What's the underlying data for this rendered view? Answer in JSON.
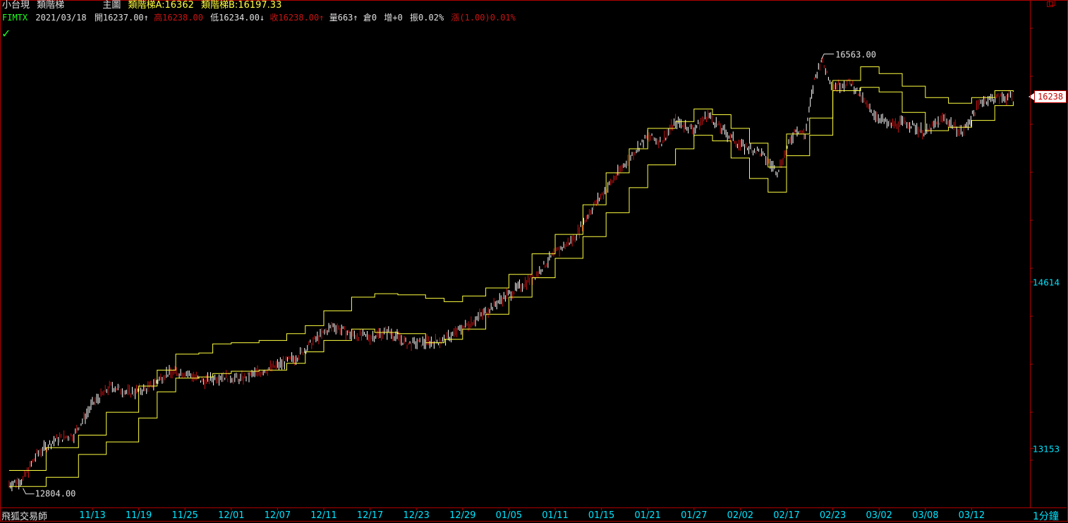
{
  "header": {
    "symbol_name": "小台現",
    "indicator_name": "類階梯",
    "panel_label": "主圖",
    "ladder_a_label": "類階梯A:16362",
    "ladder_b_label": "類階梯B:16197.33",
    "code": "FIMTX",
    "date": "2021/03/18",
    "open": "開16237.00",
    "high": "高16238.00",
    "low": "低16234.00",
    "close": "收16238.00",
    "volume": "量663",
    "oi": "倉0",
    "oi_change": "增+0",
    "amplitude": "振0.02%",
    "change": "漲(1.00)0.01%"
  },
  "footer": {
    "brand": "飛狐交易師",
    "period": "1分鐘"
  },
  "colors": {
    "background": "#000000",
    "frame": "#b00000",
    "candles": "#ffffff",
    "ladder": "#ffff40",
    "axis_text": "#00e5ff",
    "up": "#c81414",
    "accent_green": "#20ff20"
  },
  "chart_data": {
    "type": "line",
    "title": "",
    "y_tick_labels": [
      "14614",
      "13153"
    ],
    "y_ticks": [
      14614,
      13153
    ],
    "ylim": [
      12660,
      16900
    ],
    "x_labels": [
      "11/13",
      "11/19",
      "11/25",
      "12/01",
      "12/07",
      "12/11",
      "12/17",
      "12/23",
      "12/29",
      "01/05",
      "01/11",
      "01/15",
      "01/21",
      "01/27",
      "02/02",
      "02/17",
      "02/23",
      "03/02",
      "03/08",
      "03/12"
    ],
    "current_price": 16238,
    "current_price_label": "16238",
    "max_annotation": {
      "value": 16563,
      "label": "16563.00",
      "x_index": 15.75
    },
    "min_annotation": {
      "value": 12804,
      "label": "12804.00",
      "x_index": -1.5
    },
    "price_series": {
      "name": "",
      "x": [
        -1.8,
        -1.5,
        -1.2,
        -0.8,
        -0.4,
        0.0,
        0.4,
        0.8,
        1.2,
        1.6,
        2.0,
        2.4,
        2.8,
        3.2,
        3.6,
        4.0,
        4.4,
        4.8,
        5.2,
        5.6,
        6.0,
        6.4,
        6.8,
        7.2,
        7.6,
        8.0,
        8.4,
        8.8,
        9.2,
        9.6,
        10.0,
        10.4,
        10.8,
        11.2,
        11.6,
        12.0,
        12.3,
        12.6,
        13.0,
        13.3,
        13.6,
        14.0,
        14.4,
        14.8,
        15.2,
        15.4,
        15.6,
        15.75,
        16.0,
        16.4,
        16.8,
        17.2,
        17.6,
        18.0,
        18.4,
        18.8,
        19.2,
        19.6,
        19.9
      ],
      "y": [
        12840,
        12880,
        13100,
        13230,
        13270,
        13540,
        13700,
        13640,
        13680,
        13810,
        13820,
        13740,
        13790,
        13760,
        13820,
        13880,
        13950,
        14100,
        14230,
        14150,
        14130,
        14180,
        14070,
        14080,
        14100,
        14210,
        14320,
        14450,
        14560,
        14680,
        14870,
        14990,
        15260,
        15480,
        15700,
        15890,
        15840,
        16020,
        15950,
        16080,
        15950,
        15810,
        15760,
        15580,
        15960,
        15900,
        16380,
        16563,
        16330,
        16360,
        16120,
        15990,
        16010,
        15920,
        16050,
        15920,
        16200,
        16230,
        16238
      ]
    },
    "ladder_a": {
      "name": "類階梯A",
      "x": [
        -1.8,
        -1.0,
        -0.3,
        0.3,
        1.0,
        1.4,
        1.8,
        2.3,
        2.6,
        3.0,
        3.6,
        4.2,
        4.6,
        5.0,
        5.6,
        6.1,
        6.6,
        7.2,
        7.6,
        8.0,
        8.5,
        9.0,
        9.5,
        10.0,
        10.6,
        11.1,
        11.6,
        12.0,
        12.6,
        13.0,
        13.4,
        13.8,
        14.2,
        14.6,
        15.0,
        15.5,
        16.0,
        16.6,
        17.0,
        17.5,
        18.0,
        18.5,
        19.0,
        19.5,
        19.9
      ],
      "y": [
        12960,
        13160,
        13270,
        13470,
        13700,
        13840,
        13980,
        13990,
        14070,
        14080,
        14100,
        14160,
        14230,
        14360,
        14480,
        14510,
        14500,
        14470,
        14440,
        14490,
        14560,
        14680,
        14860,
        15030,
        15290,
        15570,
        15780,
        15960,
        16020,
        16130,
        16080,
        15960,
        15830,
        15620,
        15910,
        16050,
        16380,
        16500,
        16440,
        16330,
        16230,
        16180,
        16230,
        16290,
        16280
      ]
    },
    "ladder_b": {
      "name": "類階梯B",
      "x": [
        -1.8,
        -1.0,
        -0.3,
        0.3,
        1.0,
        1.4,
        1.8,
        2.3,
        2.6,
        3.0,
        3.6,
        4.2,
        4.6,
        5.0,
        5.6,
        6.1,
        6.6,
        7.2,
        7.6,
        8.0,
        8.5,
        9.0,
        9.5,
        10.0,
        10.6,
        11.1,
        11.6,
        12.0,
        12.6,
        13.0,
        13.4,
        13.8,
        14.2,
        14.6,
        15.0,
        15.5,
        16.0,
        16.6,
        17.0,
        17.5,
        18.0,
        18.5,
        19.0,
        19.5,
        19.9
      ],
      "y": [
        12820,
        12900,
        13100,
        13210,
        13420,
        13650,
        13770,
        13780,
        13810,
        13830,
        13840,
        13900,
        14000,
        14100,
        14200,
        14170,
        14160,
        14080,
        14110,
        14200,
        14330,
        14480,
        14650,
        14820,
        15010,
        15220,
        15440,
        15640,
        15780,
        15900,
        15850,
        15700,
        15520,
        15400,
        15720,
        15900,
        16290,
        16320,
        16280,
        16100,
        15940,
        15970,
        16030,
        16160,
        16197
      ]
    }
  }
}
